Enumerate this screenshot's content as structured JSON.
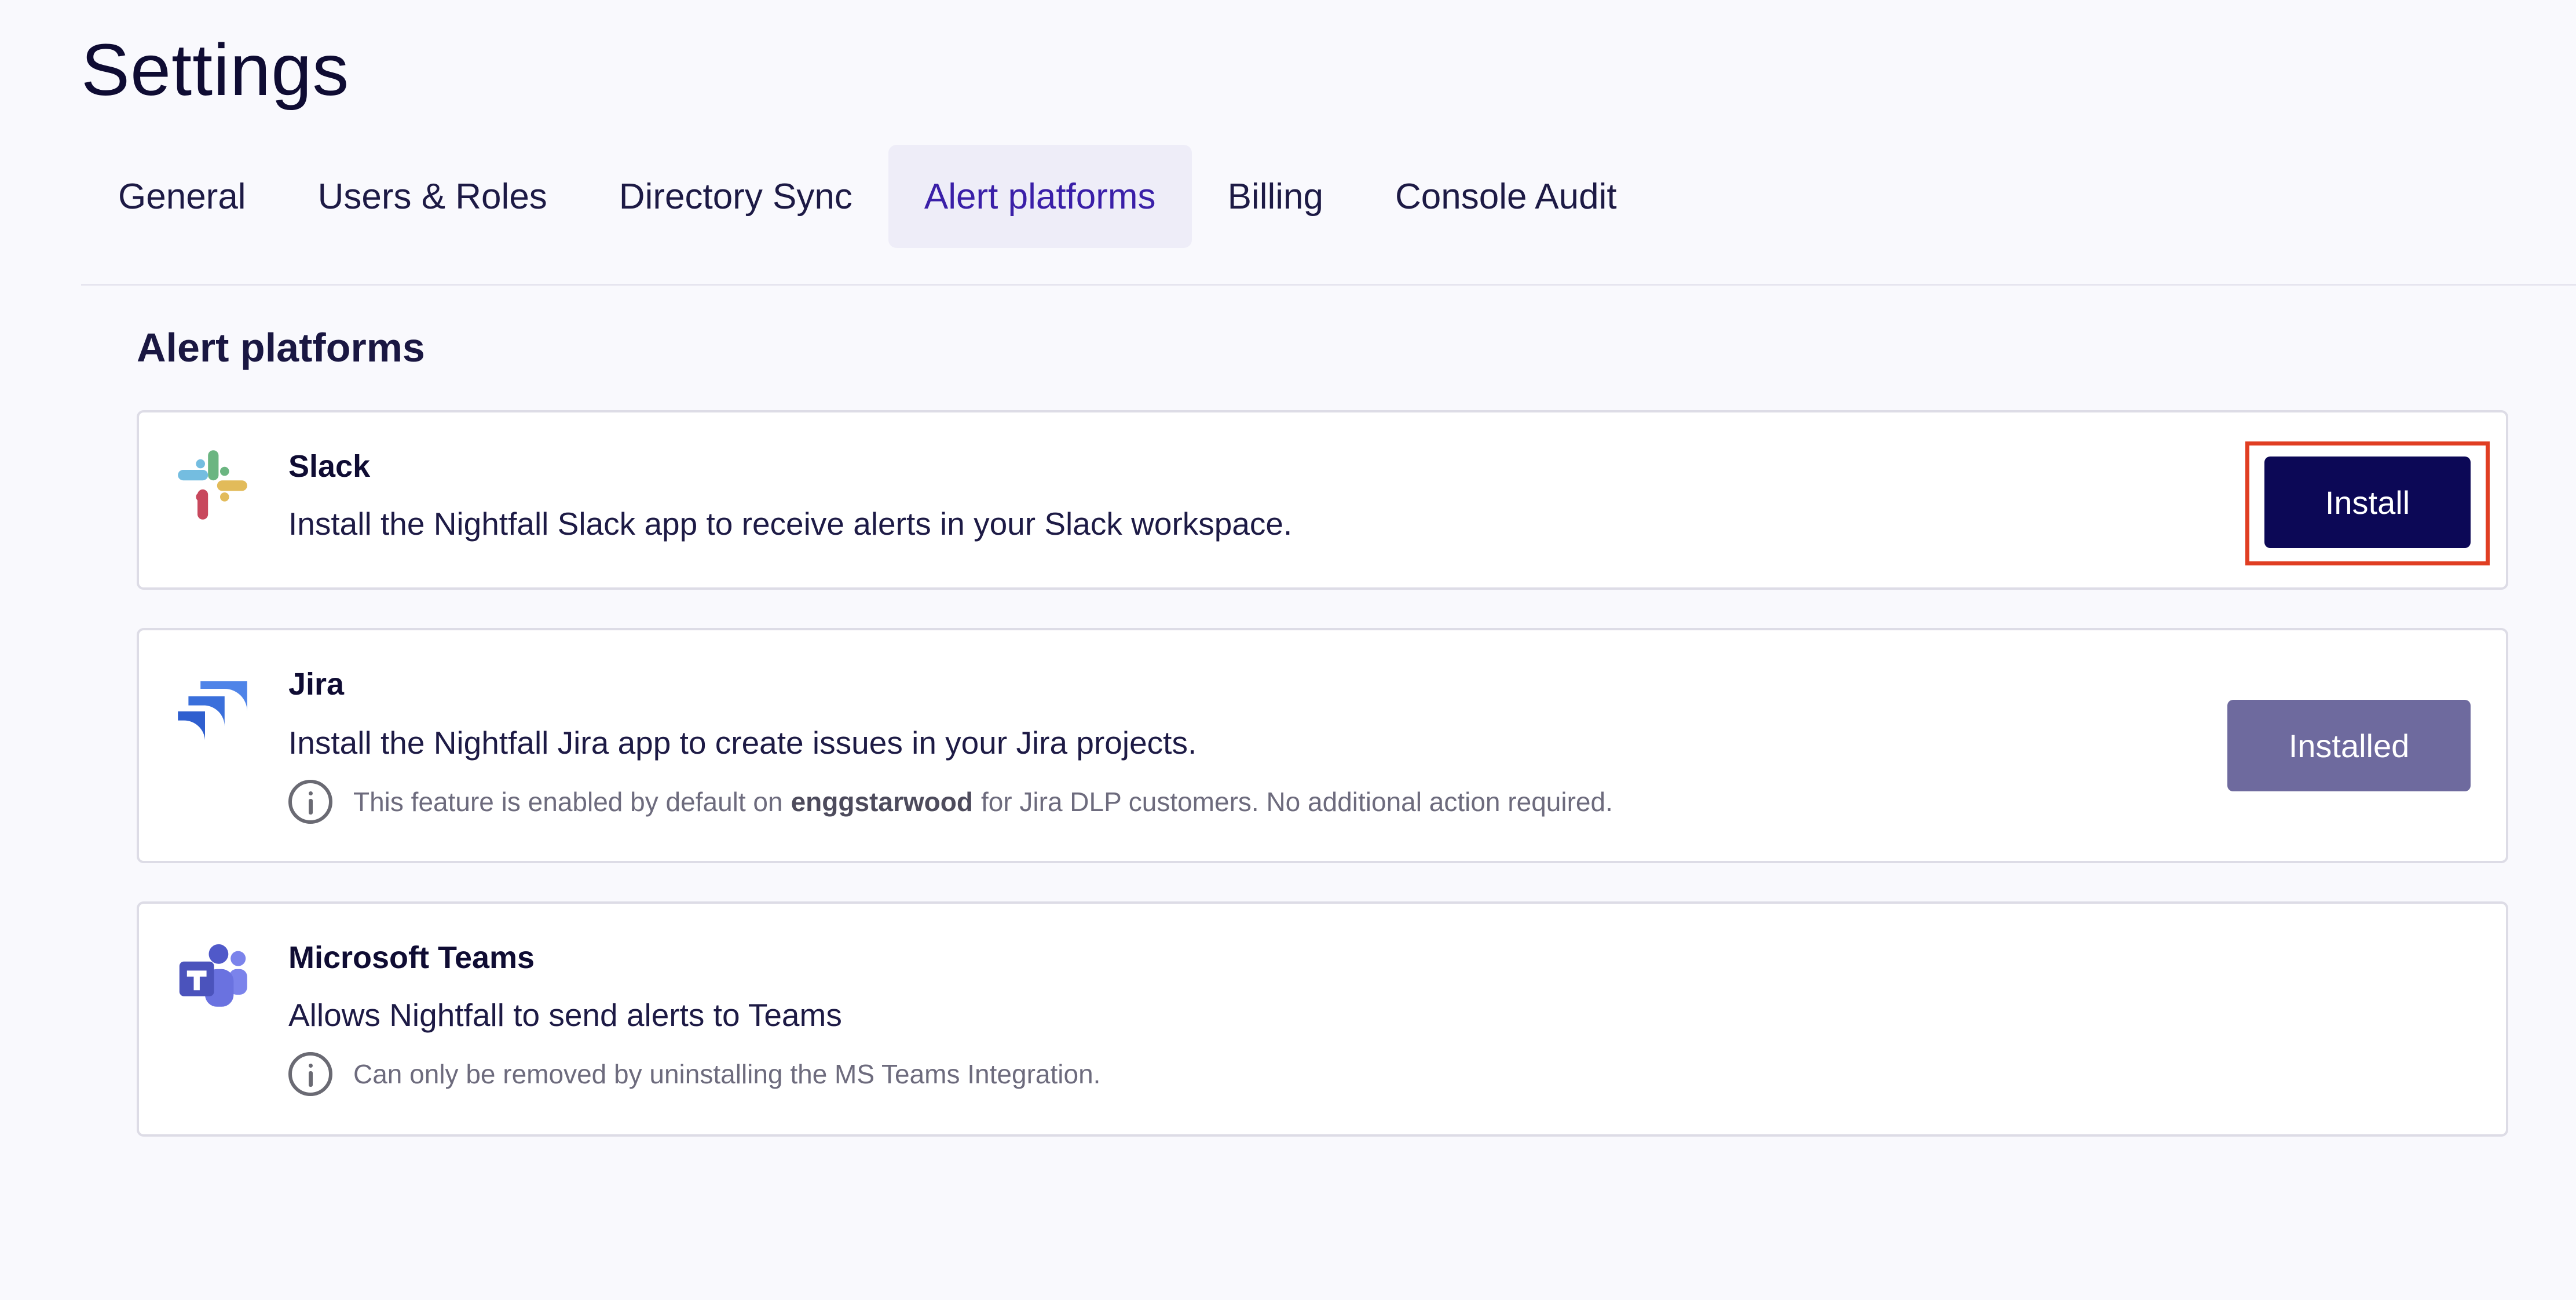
{
  "page": {
    "title": "Settings"
  },
  "tabs": [
    {
      "label": "General",
      "active": false
    },
    {
      "label": "Users & Roles",
      "active": false
    },
    {
      "label": "Directory Sync",
      "active": false
    },
    {
      "label": "Alert platforms",
      "active": true
    },
    {
      "label": "Billing",
      "active": false
    },
    {
      "label": "Console Audit",
      "active": false
    }
  ],
  "section": {
    "title": "Alert platforms"
  },
  "platforms": {
    "slack": {
      "name": "Slack",
      "description": "Install the Nightfall Slack app to receive alerts in your Slack workspace.",
      "button_label": "Install",
      "icon": "slack-logo-icon"
    },
    "jira": {
      "name": "Jira",
      "description": "Install the Nightfall Jira app to create issues in your Jira projects.",
      "note_prefix": "This feature is enabled by default on",
      "note_workspace": "enggstarwood",
      "note_suffix": "for Jira DLP customers. No additional action required.",
      "button_label": "Installed",
      "icon": "jira-logo-icon"
    },
    "teams": {
      "name": "Microsoft Teams",
      "description": "Allows Nightfall to send alerts to Teams",
      "note": "Can only be removed by uninstalling the MS Teams Integration.",
      "icon": "microsoft-teams-logo-icon"
    }
  },
  "colors": {
    "primary_button": "#0c0856",
    "disabled_button": "#6e6a9e",
    "active_tab_text": "#3a1fa8",
    "highlight_border": "#e03e22"
  }
}
